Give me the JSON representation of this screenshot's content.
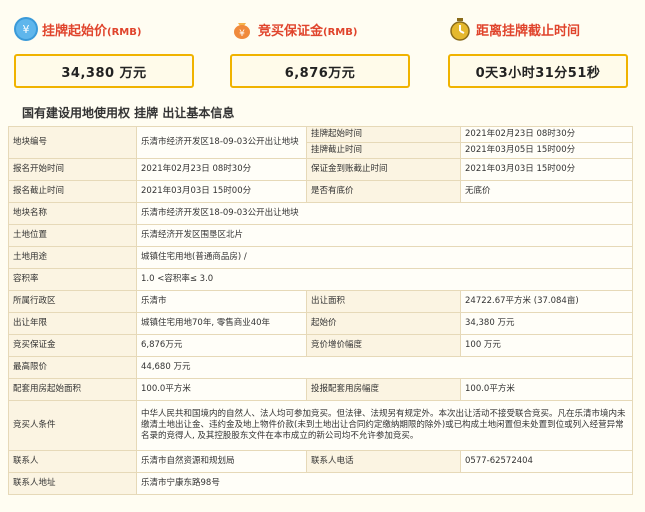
{
  "cards": [
    {
      "label": "挂牌起始价",
      "unit": "(RMB)",
      "value": "34,380 万元",
      "icon": "coin-icon",
      "color": "#3a9ad9"
    },
    {
      "label": "竞买保证金",
      "unit": "(RMB)",
      "value": "6,876万元",
      "icon": "money-bag-icon",
      "color": "#f08a3c"
    },
    {
      "label": "距离挂牌截止时间",
      "unit": "",
      "value": "0天3小时31分51秒",
      "icon": "timer-icon",
      "color": "#e5b82e"
    }
  ],
  "section_title": "国有建设用地使用权 挂牌 出让基本信息",
  "table": {
    "row1": {
      "k1": "地块编号",
      "v1": "乐清市经济开发区18-09-03公开出让地块",
      "k2a": "挂牌起始时间",
      "v2a": "2021年02月23日 08时30分",
      "k2b": "挂牌截止时间",
      "v2b": "2021年03月05日 15时00分"
    },
    "row2": {
      "k1": "报名开始时间",
      "v1": "2021年02月23日 08时30分",
      "k2": "保证金到账截止时间",
      "v2": "2021年03月03日 15时00分"
    },
    "row3": {
      "k1": "报名截止时间",
      "v1": "2021年03月03日 15时00分",
      "k2": "是否有底价",
      "v2": "无底价"
    },
    "row4": {
      "k": "地块名称",
      "v": "乐清市经济开发区18-09-03公开出让地块"
    },
    "row5": {
      "k": "土地位置",
      "v": "乐清经济开发区围垦区北片"
    },
    "row6": {
      "k": "土地用途",
      "v": "城镇住宅用地(普通商品房) /"
    },
    "row7": {
      "k": "容积率",
      "v": "1.0 <容积率≤ 3.0"
    },
    "row8": {
      "k1": "所属行政区",
      "v1": "乐清市",
      "k2": "出让面积",
      "v2": "24722.67平方米 (37.084亩)"
    },
    "row9": {
      "k1": "出让年限",
      "v1": "城镇住宅用地70年, 零售商业40年",
      "k2": "起始价",
      "v2": "34,380 万元"
    },
    "row10": {
      "k1": "竞买保证金",
      "v1": "6,876万元",
      "k2": "竞价增价幅度",
      "v2": "100 万元"
    },
    "row11": {
      "k": "最高限价",
      "v": "44,680 万元"
    },
    "row12": {
      "k1": "配套用房起始面积",
      "v1": "100.0平方米",
      "k2": "投报配套用房幅度",
      "v2": "100.0平方米"
    },
    "row13": {
      "k": "竞买人条件",
      "v": "中华人民共和国境内的自然人、法人均可参加竞买。但法律、法规另有规定外。本次出让活动不接受联合竞买。凡在乐清市境内未缴清土地出让金、违约金及地上物件价款(未到土地出让合同约定缴纳期限的除外)或已构成土地闲置但未处置到位或列入经营异常名录的竞得人, 及其控股股东文件在本市成立的新公司均不允许参加竞买。"
    },
    "row14": {
      "k1": "联系人",
      "v1": "乐清市自然资源和规划局",
      "k2": "联系人电话",
      "v2": "0577-62572404"
    },
    "row15": {
      "k": "联系人地址",
      "v": "乐清市宁康东路98号"
    }
  }
}
